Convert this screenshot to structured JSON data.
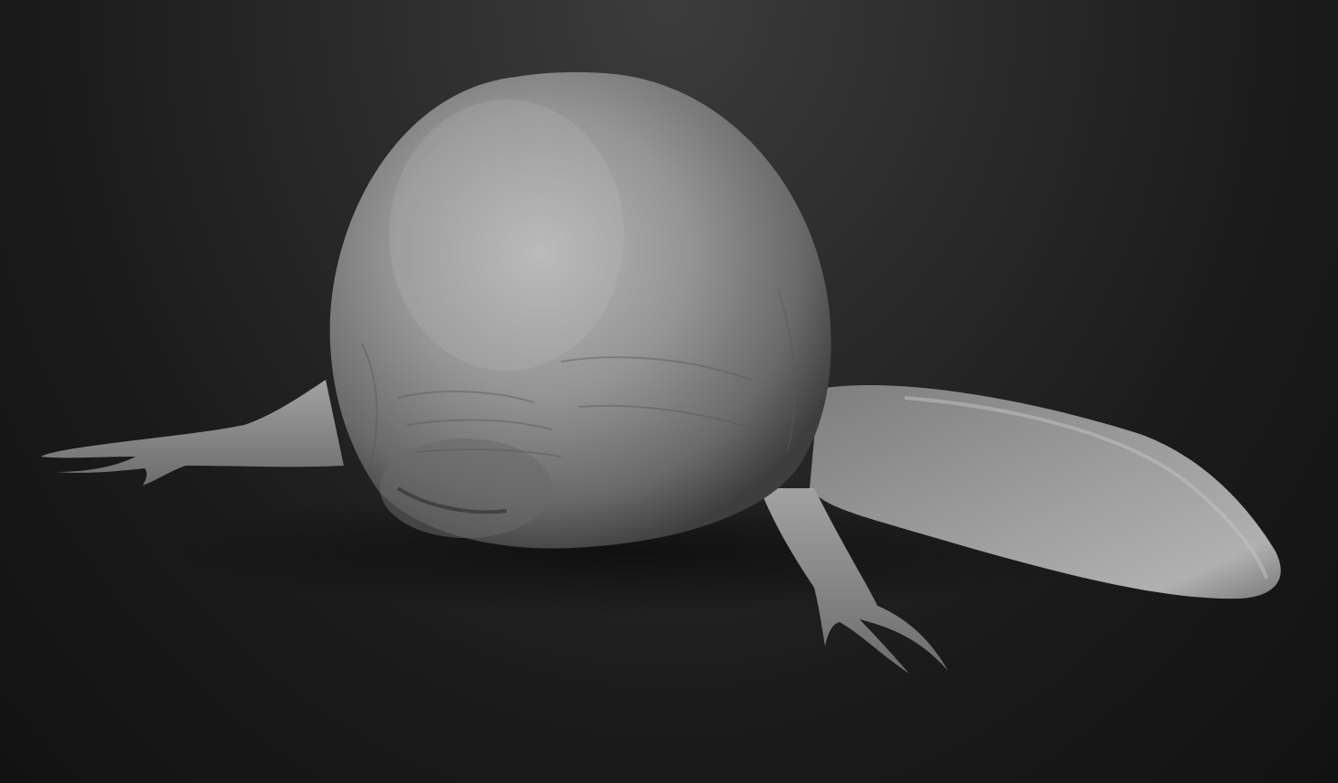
{
  "scene": {
    "subject": "creature-sculpt",
    "material": "grey-clay",
    "colors": {
      "background_top": "#3c3c3c",
      "background_bottom": "#121212",
      "clay_light": "#b4b4b4",
      "clay_mid": "#8a8a8a",
      "clay_dark": "#4a4a4a"
    }
  }
}
